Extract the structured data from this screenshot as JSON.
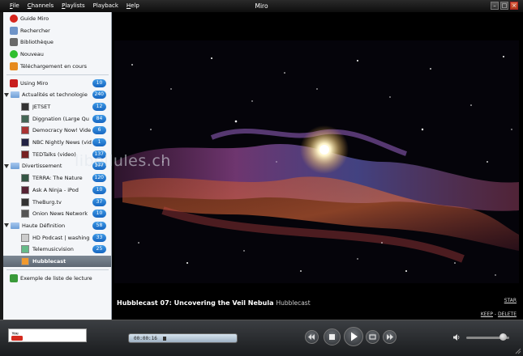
{
  "window": {
    "title": "Miro",
    "controls": [
      "minimize",
      "maximize",
      "close"
    ]
  },
  "menu": [
    {
      "label": "File",
      "hot": "F",
      "rest": "ile"
    },
    {
      "label": "Channels",
      "hot": "C",
      "rest": "hannels"
    },
    {
      "label": "Playlists",
      "hot": "P",
      "rest": "laylists"
    },
    {
      "label": "Playback",
      "hot": "",
      "rest": "Playback"
    },
    {
      "label": "Help",
      "hot": "H",
      "rest": "elp"
    }
  ],
  "sidebar": {
    "top_items": [
      {
        "label": "Guide Miro",
        "icon": "miro-guide-icon"
      },
      {
        "label": "Rechercher",
        "icon": "search-icon"
      },
      {
        "label": "Bibliothèque",
        "icon": "library-icon"
      },
      {
        "label": "Nouveau",
        "icon": "new-icon"
      },
      {
        "label": "Téléchargement en cours",
        "icon": "download-icon"
      }
    ],
    "using_miro": {
      "label": "Using Miro",
      "count": "10"
    },
    "groups": [
      {
        "label": "Actualités et technologie",
        "count": "240",
        "channels": [
          {
            "label": "JETSET",
            "count": "12"
          },
          {
            "label": "Diggnation (Large Qu",
            "count": "84"
          },
          {
            "label": "Democracy Now! Vide",
            "count": "6"
          },
          {
            "label": "NBC Nightly News (vid",
            "count": "1"
          },
          {
            "label": "TEDTalks (video)",
            "count": "137"
          }
        ]
      },
      {
        "label": "Divertissement",
        "count": "177",
        "channels": [
          {
            "label": "TERRA: The Nature",
            "count": "120"
          },
          {
            "label": "Ask A Ninja - iPod",
            "count": "10"
          },
          {
            "label": "TheBurg.tv",
            "count": "37"
          },
          {
            "label": "Onion News Network",
            "count": "10"
          }
        ]
      },
      {
        "label": "Haute Définition",
        "count": "58",
        "channels": [
          {
            "label": "HD Podcast | washing",
            "count": "33"
          },
          {
            "label": "Telemusicvision",
            "count": "25"
          },
          {
            "label": "Hubblecast",
            "count": ""
          }
        ]
      }
    ],
    "playlist": {
      "label": "Exemple de liste de lecture"
    }
  },
  "watermark": "libellules.ch",
  "video": {
    "title": "Hubblecast 07: Uncovering the Veil Nebula",
    "feed": "Hubblecast",
    "star_label": "STAR",
    "keep_label": "KEEP",
    "separator": "-",
    "delete_label": "DELETE"
  },
  "player": {
    "timecode": "00:00:16",
    "volume": 0.85,
    "progress": 0.05
  },
  "colors": {
    "badge": "#1e6fcf",
    "chrome": "#1c1e20",
    "sidebar": "#f4f6f9"
  }
}
